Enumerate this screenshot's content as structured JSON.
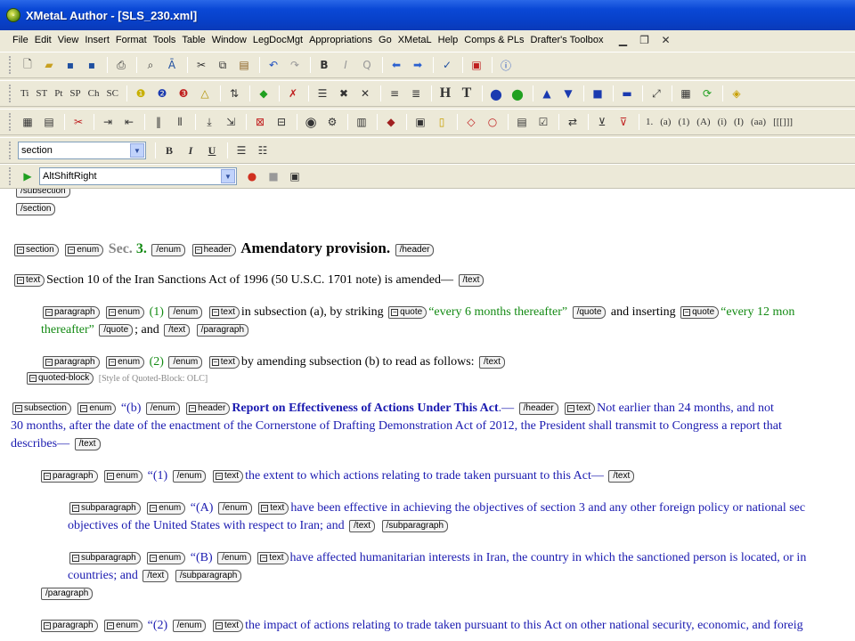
{
  "window": {
    "title": "XMetaL Author - [SLS_230.xml]"
  },
  "menu": [
    "File",
    "Edit",
    "View",
    "Insert",
    "Format",
    "Tools",
    "Table",
    "Window",
    "LegDocMgt",
    "Appropriations",
    "Go",
    "XMetaL",
    "Help",
    "Comps & PLs",
    "Drafter's Toolbox"
  ],
  "toolbar3": [
    "Ti",
    "ST",
    "Pt",
    "SP",
    "Ch",
    "SC"
  ],
  "toolbar4": [
    "1.",
    "(a)",
    "(1)",
    "(A)",
    "(i)",
    "(I)",
    "(aa)",
    "[[[]]]"
  ],
  "format_bar": {
    "style_value": "section",
    "bold": "B",
    "italic": "I",
    "underline": "U"
  },
  "macro_bar": {
    "macro_value": "AltShiftRight"
  },
  "doc": {
    "tags": {
      "subsection_close": "/subsection",
      "section_close": "/section",
      "section": "section",
      "enum": "enum",
      "enum_close": "/enum",
      "header": "header",
      "header_close": "/header",
      "text": "text",
      "text_close": "/text",
      "paragraph": "paragraph",
      "paragraph_close": "/paragraph",
      "quote": "quote",
      "quote_close": "/quote",
      "quoted_block": "quoted-block",
      "subparagraph": "subparagraph",
      "subparagraph_close": "/subparagraph"
    },
    "sec_label": "Sec. 3.",
    "sec_prefix": "Sec.",
    "sec_num": "3.",
    "heading": "Amendatory provision",
    "heading_dot": ".",
    "intro": "Section 10 of the Iran Sanctions Act of 1996 (50 U.S.C. 1701 note) is amended—",
    "p1_enum": "(1)",
    "p1_text_a": "in subsection (a), by striking",
    "p1_quote1": "“every 6 months thereafter”",
    "p1_text_b": "and inserting",
    "p1_quote2": "“every 12 mon",
    "p1_quote2_cont": "thereafter”",
    "p1_text_c": "; and",
    "p2_enum": "(2)",
    "p2_text": "by amending subsection (b) to read as follows:",
    "qb_style": "[Style of Quoted-Block: OLC]",
    "sub_enum": "“(b)",
    "sub_header": "Report on Effectiveness of Actions Under This Act",
    "sub_header_dash": ".—",
    "sub_text_1": "Not earlier than 24 months, and not",
    "sub_text_2": "30 months, after the date of the enactment of the Cornerstone of Drafting Demonstration Act of 2012, the President shall transmit to Congress a report that",
    "sub_text_3": "describes—",
    "qp1_enum": "“(1)",
    "qp1_text": "the extent to which actions relating to trade taken pursuant to this Act—",
    "sa_enum": "“(A)",
    "sa_text_1": "have been effective in achieving the objectives of section 3 and any other foreign policy or national sec",
    "sa_text_2": "objectives of the United States with respect to Iran; and",
    "sb_enum": "“(B)",
    "sb_text_1": "have affected humanitarian interests in Iran, the country in which the sanctioned person is located, or in",
    "sb_text_2": "countries; and",
    "qp2_enum": "“(2)",
    "qp2_text": "the impact of actions relating to trade taken pursuant to this Act on other national security, economic, and foreig"
  }
}
